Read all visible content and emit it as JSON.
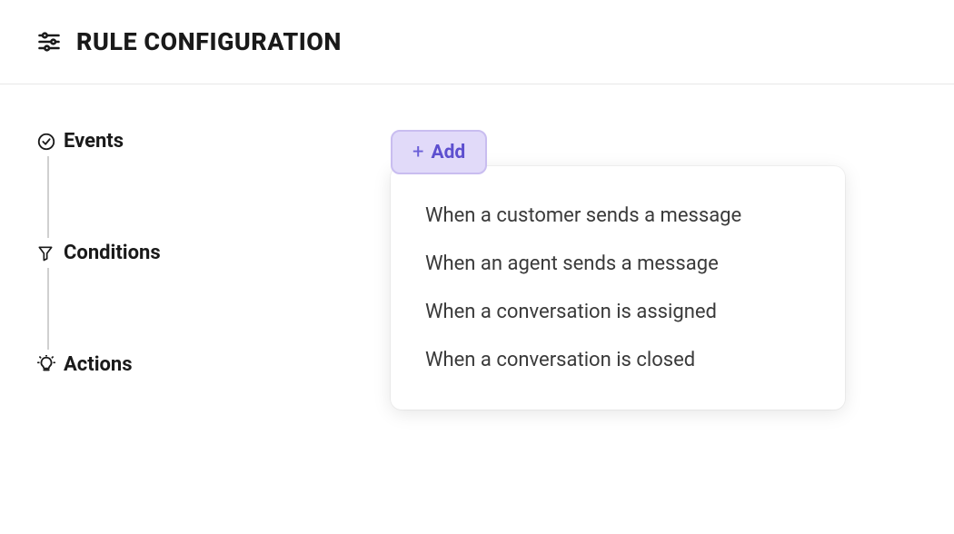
{
  "header": {
    "title": "RULE CONFIGURATION"
  },
  "sidebar": {
    "items": [
      {
        "label": "Events",
        "icon": "clock-check-icon"
      },
      {
        "label": "Conditions",
        "icon": "funnel-icon"
      },
      {
        "label": "Actions",
        "icon": "lightbulb-icon"
      }
    ]
  },
  "main": {
    "add_button_label": "Add",
    "dropdown_items": [
      "When a customer sends a message",
      "When an agent sends a message",
      "When a conversation is assigned",
      "When a conversation is closed"
    ]
  }
}
